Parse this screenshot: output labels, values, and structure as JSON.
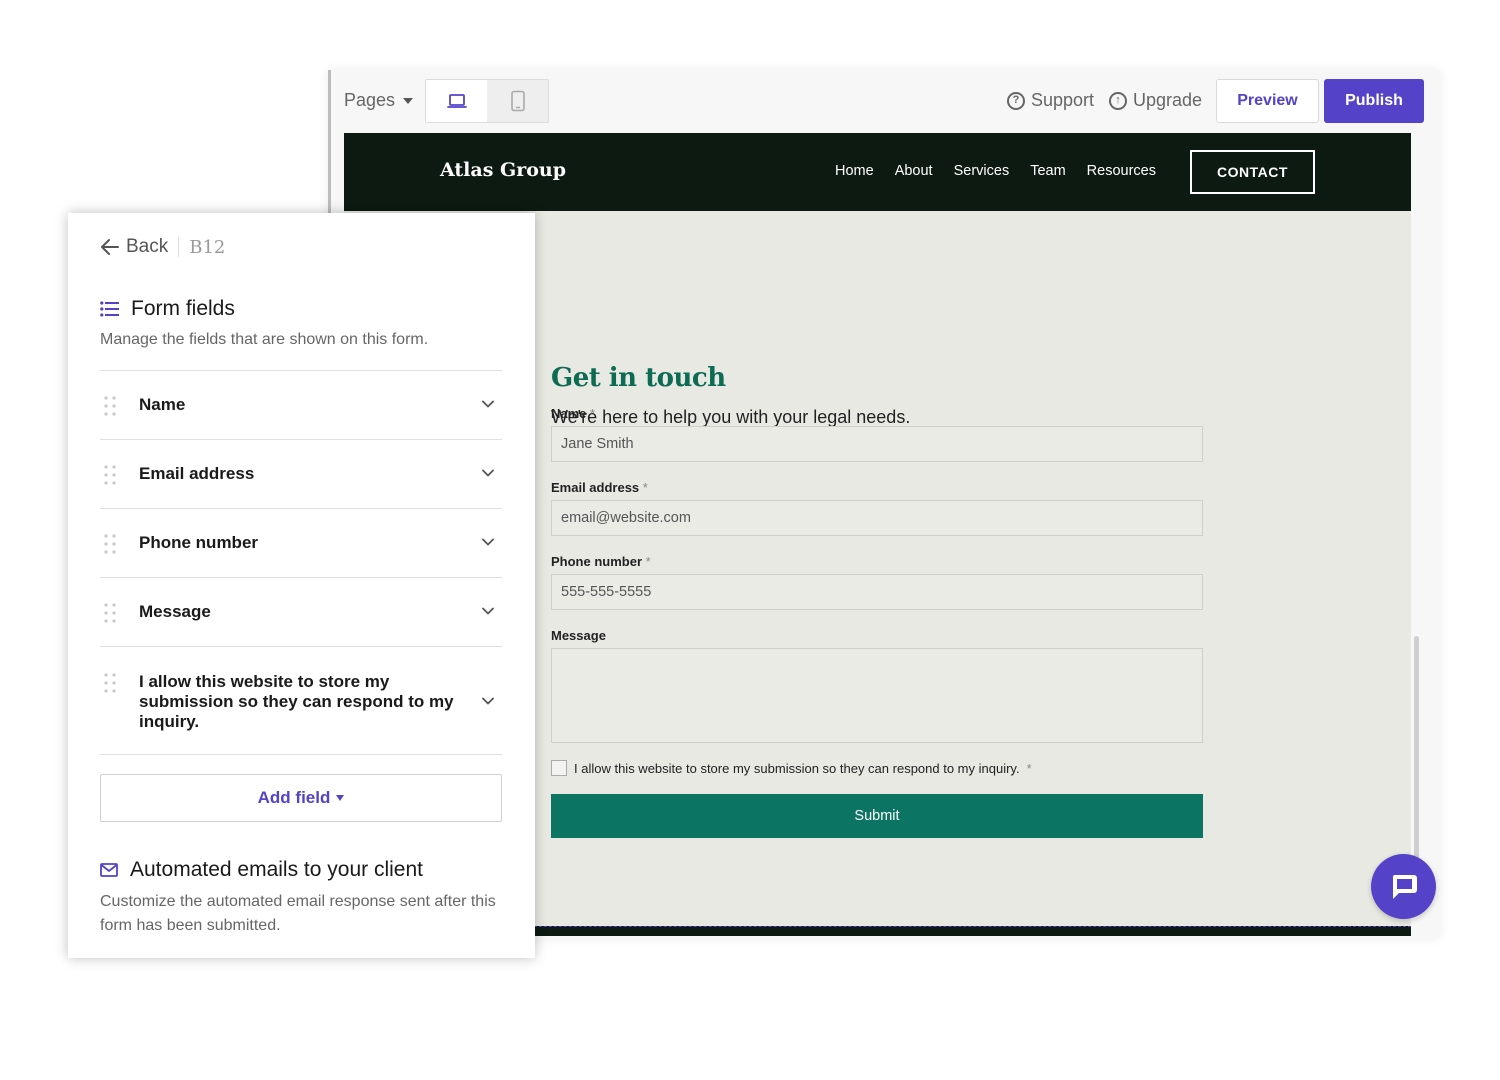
{
  "toolbar": {
    "pages_label": "Pages",
    "support_label": "Support",
    "upgrade_label": "Upgrade",
    "preview_label": "Preview",
    "publish_label": "Publish",
    "active_device": "desktop"
  },
  "site": {
    "brand": "Atlas Group",
    "nav": [
      "Home",
      "About",
      "Services",
      "Team",
      "Resources"
    ],
    "contact_label": "CONTACT",
    "heading": "Get in touch",
    "subheading": "We're here to help you with your legal needs.",
    "form": {
      "name_label": "Name",
      "name_placeholder": "Jane Smith",
      "email_label": "Email address",
      "email_placeholder": "email@website.com",
      "phone_label": "Phone number",
      "phone_placeholder": "555-555-5555",
      "message_label": "Message",
      "required_mark": "*",
      "consent_label": "I allow this website to store my submission so they can respond to my inquiry.",
      "submit_label": "Submit"
    }
  },
  "panel": {
    "back_label": "Back",
    "logo": "B12",
    "form_fields_title": "Form fields",
    "form_fields_desc": "Manage the fields that are shown on this form.",
    "fields": [
      "Name",
      "Email address",
      "Phone number",
      "Message",
      "I allow this website to store my submission so they can respond to my inquiry."
    ],
    "add_field_label": "Add field",
    "emails_title": "Automated emails to your client",
    "emails_desc": "Customize the automated email response sent after this form has been submitted."
  },
  "colors": {
    "accent": "#5443c9",
    "site_dark": "#0c1a11",
    "site_green": "#0c6b52",
    "submit_green": "#0b7462",
    "site_bg": "#e9e9e4"
  },
  "icons": [
    "caret-down-icon",
    "laptop-icon",
    "tablet-icon",
    "question-circle-icon",
    "upload-circle-icon",
    "arrow-left-icon",
    "list-icon",
    "drag-handle-icon",
    "chevron-down-icon",
    "mail-icon",
    "chat-icon"
  ]
}
